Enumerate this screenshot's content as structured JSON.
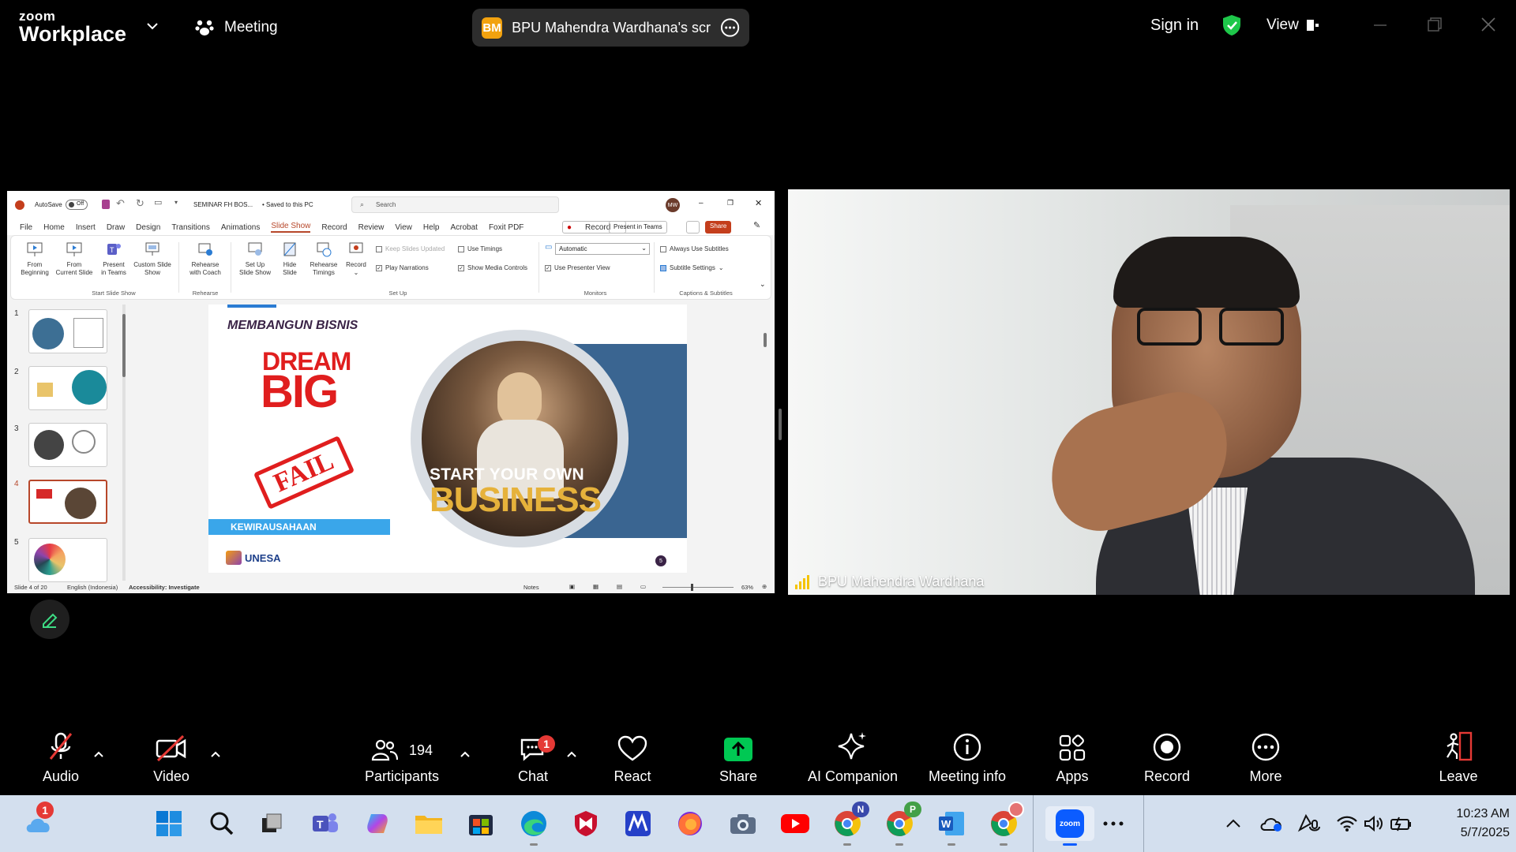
{
  "app": {
    "logo_line1": "zoom",
    "logo_line2": "Workplace",
    "meeting_label": "Meeting",
    "share_avatar": "BM",
    "share_label": "BPU Mahendra Wardhana's scree",
    "sign_in": "Sign in",
    "view": "View"
  },
  "ppt": {
    "autosave": "AutoSave",
    "autosave_state": "Off",
    "filename": "SEMINAR FH BOS...",
    "saved": "• Saved to this PC",
    "search_placeholder": "Search",
    "user_initials": "MW",
    "menu": [
      "File",
      "Home",
      "Insert",
      "Draw",
      "Design",
      "Transitions",
      "Animations",
      "Slide Show",
      "Record",
      "Review",
      "View",
      "Help",
      "Acrobat",
      "Foxit PDF"
    ],
    "record_btn": "Record",
    "present_teams_btn": "Present in Teams",
    "share_btn": "Share",
    "ribbon": {
      "from_beginning": [
        "From",
        "Beginning"
      ],
      "from_current": [
        "From",
        "Current Slide"
      ],
      "present_teams": [
        "Present",
        "in Teams"
      ],
      "custom_show": [
        "Custom Slide",
        "Show"
      ],
      "rehearse_coach": [
        "Rehearse",
        "with Coach"
      ],
      "setup_show": [
        "Set Up",
        "Slide Show"
      ],
      "hide_slide": [
        "Hide",
        "Slide"
      ],
      "rehearse_timings": [
        "Rehearse",
        "Timings"
      ],
      "record": "Record",
      "keep_updated": "Keep Slides Updated",
      "play_narrations": "Play Narrations",
      "use_timings": "Use Timings",
      "show_media": "Show Media Controls",
      "monitor_select": "Automatic",
      "presenter_view": "Use Presenter View",
      "always_subtitles": "Always Use Subtitles",
      "subtitle_settings": "Subtitle Settings",
      "groups": [
        "Start Slide Show",
        "Rehearse",
        "Set Up",
        "Monitors",
        "Captions & Subtitles"
      ]
    },
    "slide_numbers": [
      "1",
      "2",
      "3",
      "4",
      "5"
    ],
    "slide": {
      "heading": "MEMBANGUN BISNIS",
      "dream": "DREAM",
      "big": "BIG",
      "fail": "FAIL",
      "start_your_own": "START YOUR OWN",
      "business": "BUSINESS",
      "bar_label": "KEWIRAUSAHAAN",
      "logo_text": "UNESA",
      "page_badge": "5"
    },
    "status": {
      "slide_of": "Slide 4 of 20",
      "language": "English (Indonesia)",
      "accessibility": "Accessibility: Investigate",
      "notes": "Notes",
      "zoom": "63%"
    }
  },
  "video": {
    "participant_name": "BPU Mahendra Wardhana"
  },
  "toolbar": {
    "audio": "Audio",
    "video": "Video",
    "participants": "Participants",
    "participants_count": "194",
    "chat": "Chat",
    "chat_badge": "1",
    "react": "React",
    "share": "Share",
    "ai_companion": "AI Companion",
    "meeting_info": "Meeting info",
    "apps": "Apps",
    "record": "Record",
    "more": "More",
    "leave": "Leave"
  },
  "taskbar": {
    "weather_badge": "1",
    "chrome_badge_1": "N",
    "chrome_badge_2": "P",
    "time": "10:23 AM",
    "date": "5/7/2025",
    "zoom_label": "zoom"
  },
  "colors": {
    "ppt_accent": "#b7472a",
    "zoom_blue": "#0b5cff",
    "share_green": "#00c853",
    "alert_red": "#e53935"
  }
}
